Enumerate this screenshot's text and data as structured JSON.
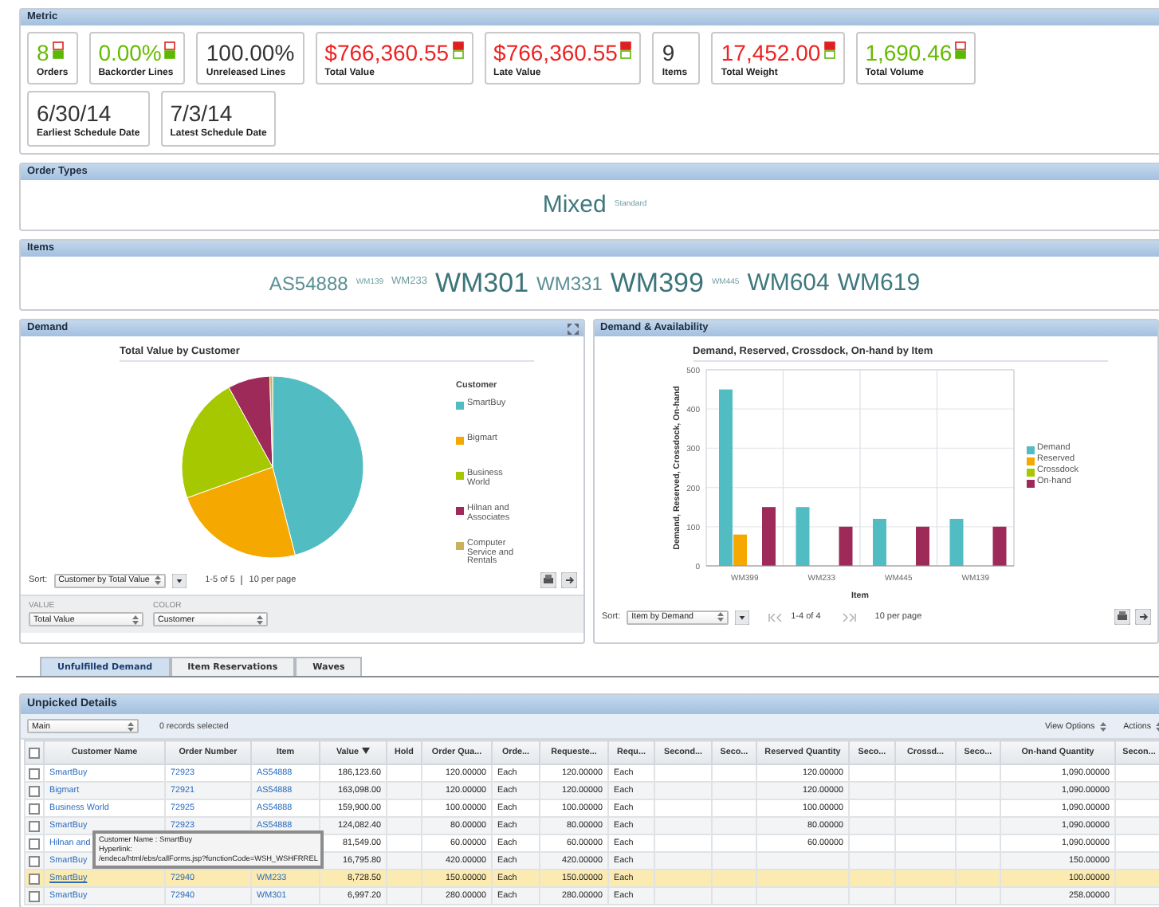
{
  "metric_panel": {
    "title": "Metric",
    "summary_cards": [
      {
        "value": "8",
        "label": "Orders",
        "kind": "good"
      },
      {
        "value": "0.00%",
        "label": "Backorder Lines",
        "kind": "good"
      },
      {
        "value": "100.00%",
        "label": "Unreleased Lines",
        "kind": "plain"
      },
      {
        "value": "$766,360.55",
        "label": "Total Value",
        "kind": "bad"
      },
      {
        "value": "$766,360.55",
        "label": "Late Value",
        "kind": "bad"
      },
      {
        "value": "9",
        "label": "Items",
        "kind": "plain"
      },
      {
        "value": "17,452.00",
        "label": "Total Weight",
        "kind": "bad"
      },
      {
        "value": "1,690.46",
        "label": "Total Volume",
        "kind": "good"
      }
    ],
    "date_cards": [
      {
        "value": "6/30/14",
        "label": "Earliest Schedule Date"
      },
      {
        "value": "7/3/14",
        "label": "Latest Schedule Date"
      }
    ]
  },
  "order_types": {
    "title": "Order Types",
    "tags": [
      {
        "label": "Mixed",
        "kind": "large"
      },
      {
        "label": "Standard",
        "kind": "tiny"
      }
    ]
  },
  "items": {
    "title": "Items",
    "tags": [
      {
        "label": "AS54888",
        "kind": "medium"
      },
      {
        "label": "WM139",
        "kind": "tiny"
      },
      {
        "label": "WM233",
        "kind": "small"
      },
      {
        "label": "WM301",
        "kind": "huge"
      },
      {
        "label": "WM331",
        "kind": "medium"
      },
      {
        "label": "WM399",
        "kind": "huge"
      },
      {
        "label": "WM445",
        "kind": "tiny"
      },
      {
        "label": "WM604",
        "kind": "large"
      },
      {
        "label": "WM619",
        "kind": "large"
      }
    ]
  },
  "demand": {
    "title": "Demand",
    "chart_title": "Total Value by Customer",
    "legend_title": "Customer",
    "legend": [
      {
        "label": "SmartBuy",
        "color": "#52bcc3"
      },
      {
        "label": "Bigmart",
        "color": "#f5a800"
      },
      {
        "label": "Business World",
        "color": "#a6c800"
      },
      {
        "label": "Hilnan and Associates",
        "color": "#9e2a5a"
      },
      {
        "label": "Computer Service and Rentals",
        "color": "#c9b25a"
      }
    ],
    "sort_label": "Sort:",
    "sort_value": "Customer by Total Value",
    "range": "1-5 of 5",
    "per_page": "10 per page",
    "fields": [
      {
        "label": "VALUE",
        "value": "Total Value"
      },
      {
        "label": "COLOR",
        "value": "Customer"
      }
    ]
  },
  "availability": {
    "title": "Demand & Availability",
    "chart_data": {
      "type": "bar",
      "title": "Demand, Reserved, Crossdock, On-hand by Item",
      "xlabel": "Item",
      "ylabel": "Demand, Reserved, Crossdock, On-hand",
      "categories": [
        "WM399",
        "WM233",
        "WM445",
        "WM139"
      ],
      "ylim": [
        0,
        500
      ],
      "grid": true,
      "yticks": [
        0,
        100,
        200,
        300,
        400,
        500
      ],
      "series": [
        {
          "name": "Demand",
          "color": "#52bcc3",
          "values": [
            450,
            150,
            120,
            120
          ]
        },
        {
          "name": "Reserved",
          "color": "#f5a800",
          "values": [
            80,
            0,
            0,
            0
          ]
        },
        {
          "name": "Crossdock",
          "color": "#a6c800",
          "values": [
            0,
            0,
            0,
            0
          ]
        },
        {
          "name": "On-hand",
          "color": "#9e2a5a",
          "values": [
            150,
            100,
            100,
            100
          ]
        }
      ]
    },
    "sort_label": "Sort:",
    "sort_value": "Item by Demand",
    "range": "1-4 of 4",
    "per_page": "10 per page"
  },
  "tabs": [
    {
      "label": "Unfulfilled Demand",
      "selected": true
    },
    {
      "label": "Item Reservations",
      "selected": false
    },
    {
      "label": "Waves",
      "selected": false
    }
  ],
  "details": {
    "title": "Unpicked Details",
    "view": "Main",
    "records": "0 records selected",
    "view_options": "View Options",
    "actions": "Actions",
    "header_checked": false,
    "columns": [
      {
        "label": "Customer Name",
        "kind": "link",
        "sorted": false
      },
      {
        "label": "Order Number",
        "kind": "link",
        "sorted": false
      },
      {
        "label": "Item",
        "kind": "link",
        "sorted": false
      },
      {
        "label": "Value",
        "kind": "number",
        "sorted": true
      },
      {
        "label": "Hold",
        "kind": "text",
        "sorted": false
      },
      {
        "label": "Order Qua...",
        "kind": "number",
        "sorted": false
      },
      {
        "label": "Orde...",
        "kind": "text",
        "sorted": false
      },
      {
        "label": "Requeste...",
        "kind": "number",
        "sorted": false
      },
      {
        "label": "Requ...",
        "kind": "text",
        "sorted": false
      },
      {
        "label": "Second...",
        "kind": "number",
        "sorted": false
      },
      {
        "label": "Seco...",
        "kind": "text",
        "sorted": false
      },
      {
        "label": "Reserved Quantity",
        "kind": "number",
        "sorted": false
      },
      {
        "label": "Seco...",
        "kind": "text",
        "sorted": false
      },
      {
        "label": "Crossd...",
        "kind": "number",
        "sorted": false
      },
      {
        "label": "Seco...",
        "kind": "text",
        "sorted": false
      },
      {
        "label": "On-hand Quantity",
        "kind": "number",
        "sorted": false
      },
      {
        "label": "Secon...",
        "kind": "text",
        "sorted": false
      }
    ],
    "rows": [
      {
        "checked": false,
        "selected": false,
        "cells": [
          "SmartBuy",
          "72923",
          "AS54888",
          "186,123.60",
          null,
          "120.00000",
          "Each",
          "120.00000",
          "Each",
          null,
          null,
          "120.00000",
          null,
          null,
          null,
          "1,090.00000",
          null
        ]
      },
      {
        "checked": false,
        "selected": false,
        "cells": [
          "Bigmart",
          "72921",
          "AS54888",
          "163,098.00",
          null,
          "120.00000",
          "Each",
          "120.00000",
          "Each",
          null,
          null,
          "120.00000",
          null,
          null,
          null,
          "1,090.00000",
          null
        ]
      },
      {
        "checked": false,
        "selected": false,
        "cells": [
          "Business World",
          "72925",
          "AS54888",
          "159,900.00",
          null,
          "100.00000",
          "Each",
          "100.00000",
          "Each",
          null,
          null,
          "100.00000",
          null,
          null,
          null,
          "1,090.00000",
          null
        ]
      },
      {
        "checked": false,
        "selected": false,
        "cells": [
          "SmartBuy",
          "72923",
          "AS54888",
          "124,082.40",
          null,
          "80.00000",
          "Each",
          "80.00000",
          "Each",
          null,
          null,
          "80.00000",
          null,
          null,
          null,
          "1,090.00000",
          null
        ]
      },
      {
        "checked": false,
        "selected": false,
        "cells": [
          "Hilnan and",
          null,
          null,
          "81,549.00",
          null,
          "60.00000",
          "Each",
          "60.00000",
          "Each",
          null,
          null,
          "60.00000",
          null,
          null,
          null,
          "1,090.00000",
          null
        ]
      },
      {
        "checked": false,
        "selected": false,
        "cells": [
          "SmartBuy",
          null,
          null,
          "16,795.80",
          null,
          "420.00000",
          "Each",
          "420.00000",
          "Each",
          null,
          null,
          null,
          null,
          null,
          null,
          "150.00000",
          null
        ]
      },
      {
        "checked": false,
        "selected": true,
        "cells": [
          "SmartBuy",
          "72940",
          "WM233",
          "8,728.50",
          null,
          "150.00000",
          "Each",
          "150.00000",
          "Each",
          null,
          null,
          null,
          null,
          null,
          null,
          "100.00000",
          null
        ]
      },
      {
        "checked": false,
        "selected": false,
        "cells": [
          "SmartBuy",
          "72940",
          "WM301",
          "6,997.20",
          null,
          "280.00000",
          "Each",
          "280.00000",
          "Each",
          null,
          null,
          null,
          null,
          null,
          null,
          "258.00000",
          null
        ]
      }
    ],
    "tooltip": {
      "lines": [
        "Customer Name : SmartBuy",
        "Hyperlink:",
        "/endeca/html/ebs/callForms.jsp?functionCode=WSH_WSHFRREL"
      ]
    }
  }
}
